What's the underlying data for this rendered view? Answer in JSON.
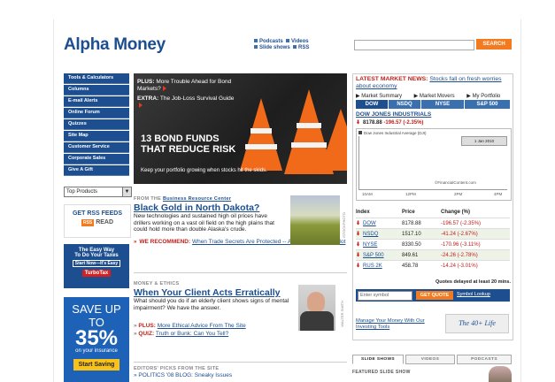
{
  "header": {
    "logo": "Alpha Money",
    "links": [
      "Podcasts",
      "Videos",
      "Slide shows",
      "RSS"
    ],
    "search_button": "SEARCH"
  },
  "sidebar": {
    "nav": [
      "Tools & Calculators",
      "Columns",
      "E-mail Alerts",
      "Online Forum",
      "Quizzes",
      "Site Map",
      "Customer Service",
      "Corporate Sales",
      "Give A Gift"
    ],
    "select_value": "Top Products",
    "rss_title": "GET RSS FEEDS",
    "rss_badge": "RSS",
    "rss_read": "READ",
    "tax_line1": "The Easy Way",
    "tax_line2": "To Do Your Taxes",
    "tax_start": "Start Now—It's Easy",
    "tax_brand": "TurboTax",
    "save_line1": "SAVE UP TO",
    "save_pct": "35%",
    "save_line2": "on your insurance",
    "save_button": "Start Saving"
  },
  "hero": {
    "plus_label": "PLUS:",
    "plus_text": "More Trouble Ahead for Bond Markets?",
    "extra_label": "EXTRA:",
    "extra_text": "The Job-Loss Survival Guide",
    "headline": "13 BOND FUNDS THAT REDUCE RISK",
    "subtext": "Keep your portfolio growing when stocks hit the skids."
  },
  "story1": {
    "kicker_prefix": "FROM THE",
    "kicker_link": "Business Resource Center",
    "title": "Black Gold in North Dakota?",
    "body": "New technologies and sustained high oil prices have drillers working on a vast oil field on the high plains that could hold more than double Alaska's crude.",
    "rec_label": "WE RECOMMEND:",
    "rec_link": "When Trade Secrets Are Protected -- And When They're Not",
    "caption": "ISTOCKPHOTO"
  },
  "story2": {
    "kicker": "MONEY & ETHICS",
    "title": "When Your Client Acts Erratically",
    "body": "What should you do if an elderly client shows signs of mental impairment? We have the answer.",
    "plus_label": "PLUS:",
    "plus_link": "More Ethical Advice From The Site",
    "quiz_label": "QUIZ:",
    "quiz_link": "Truth or Bunk: Can You Tell?",
    "caption": "WALTER SMITH"
  },
  "story3": {
    "kicker": "EDITORS' PICKS FROM THE SITE",
    "item": "POLITICS '08 BLOG: Sneaky Issues"
  },
  "market": {
    "news_label": "LATEST MARKET NEWS:",
    "news_link": "Stocks fall on fresh worries about economy",
    "links": [
      "Market Summary",
      "Market Movers",
      "My Portfolio"
    ],
    "tabs": [
      "DOW",
      "NSDQ",
      "NYSE",
      "S&P 500"
    ],
    "dj_title": "DOW JONES INDUSTRIALS",
    "dj_value": "8178.88",
    "dj_change": "-196.57 (-2.35%)",
    "chart_legend": "Dow Jones Industrial Average (DJI)",
    "chart_date": "1 Jan 2010",
    "chart_credit": "©FinancialContent.com",
    "chart_times": [
      "10AM",
      "12PM",
      "2PM",
      "4PM"
    ],
    "table_headers": [
      "Index",
      "Price",
      "Change (%)"
    ],
    "rows": [
      {
        "name": "DOW",
        "price": "8178.88",
        "change": "-196.57 (-2.35%)"
      },
      {
        "name": "NSDQ",
        "price": "1517.10",
        "change": "-41.24 (-2.67%)"
      },
      {
        "name": "NYSE",
        "price": "8330.50",
        "change": "-170.96 (-3.11%)"
      },
      {
        "name": "S&P 500",
        "price": "849.61",
        "change": "-24.26 (-2.78%)"
      },
      {
        "name": "RUS 2K",
        "price": "458.78",
        "change": "-14.24 (-3.01%)"
      }
    ],
    "delay_note": "Quotes delayed at least 20 mins.",
    "symbol_placeholder": "Enter symbol",
    "get_quote": "GET QUOTE",
    "symbol_lookup": "Symbol Lookup",
    "manage_link": "Manage Your Money With Our Investing Tools",
    "fortyplus": "The 40+ Life"
  },
  "slides": {
    "tabs": [
      "SLIDE SHOWS",
      "VIDEOS",
      "PODCASTS"
    ],
    "featured": "FEATURED SLIDE SHOW"
  }
}
